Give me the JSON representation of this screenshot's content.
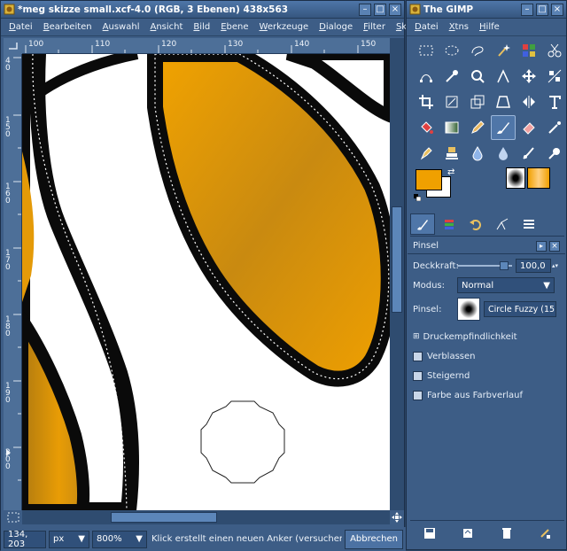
{
  "image_window": {
    "title": "*meg skizze small.xcf-4.0 (RGB, 3 Ebenen) 438x563",
    "menu": [
      "Datei",
      "Bearbeiten",
      "Auswahl",
      "Ansicht",
      "Bild",
      "Ebene",
      "Werkzeuge",
      "Dialoge",
      "Filter",
      "Skript-Fu"
    ],
    "ruler_h_labels": [
      "100",
      "110",
      "120",
      "130",
      "140",
      "150"
    ],
    "ruler_v_labels": [
      "40",
      "150",
      "160",
      "170",
      "180",
      "190",
      "200"
    ],
    "status": {
      "coords": "134, 203",
      "unit": "px",
      "zoom": "800%",
      "message": "Klick erstellt einen neuen Anker (versuchen Sie die U",
      "cancel": "Abbrechen"
    }
  },
  "toolbox_window": {
    "title": "The GIMP",
    "menu": [
      "Datei",
      "Xtns",
      "Hilfe"
    ],
    "colors": {
      "foreground": "#f0a000",
      "background": "#ffffff"
    },
    "tool_options": {
      "title": "Pinsel",
      "opacity_label": "Deckkraft:",
      "opacity_value": "100,0",
      "mode_label": "Modus:",
      "mode_value": "Normal",
      "brush_label": "Pinsel:",
      "brush_value": "Circle Fuzzy (15)",
      "pressure_label": "Druckempfindlichkeit",
      "checkboxes": [
        "Verblassen",
        "Steigernd",
        "Farbe aus Farbverlauf"
      ]
    }
  }
}
